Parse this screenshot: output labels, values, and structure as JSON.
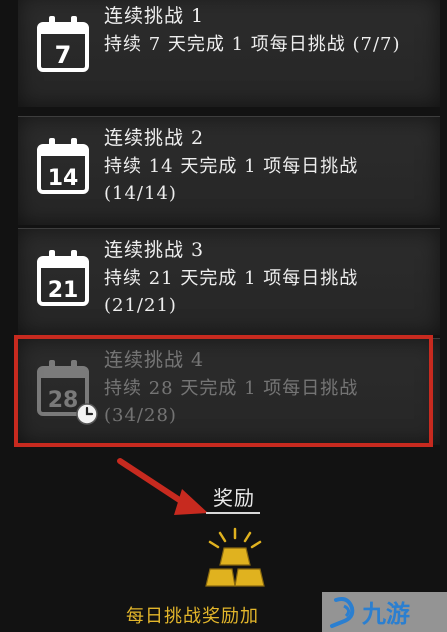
{
  "challenges": [
    {
      "title": "连续挑战 1",
      "description": "持续 7 天完成 1 项每日挑战 (7/7)",
      "day": "7",
      "locked": false
    },
    {
      "title": "连续挑战 2",
      "description": "持续 14 天完成 1 项每日挑战 (14/14)",
      "day": "14",
      "locked": false
    },
    {
      "title": "连续挑战 3",
      "description": "持续 21 天完成 1 项每日挑战 (21/21)",
      "day": "21",
      "locked": false
    },
    {
      "title": "连续挑战 4",
      "description": "持续 28 天完成 1 项每日挑战 (34/28)",
      "day": "28",
      "locked": true
    }
  ],
  "reward": {
    "label": "奖励",
    "name": "每日挑战奖励加"
  },
  "watermark": {
    "text": "九游"
  },
  "colors": {
    "highlight": "#c72a1f",
    "reward_text": "#e3b62b",
    "gold": "#e0b21f"
  }
}
